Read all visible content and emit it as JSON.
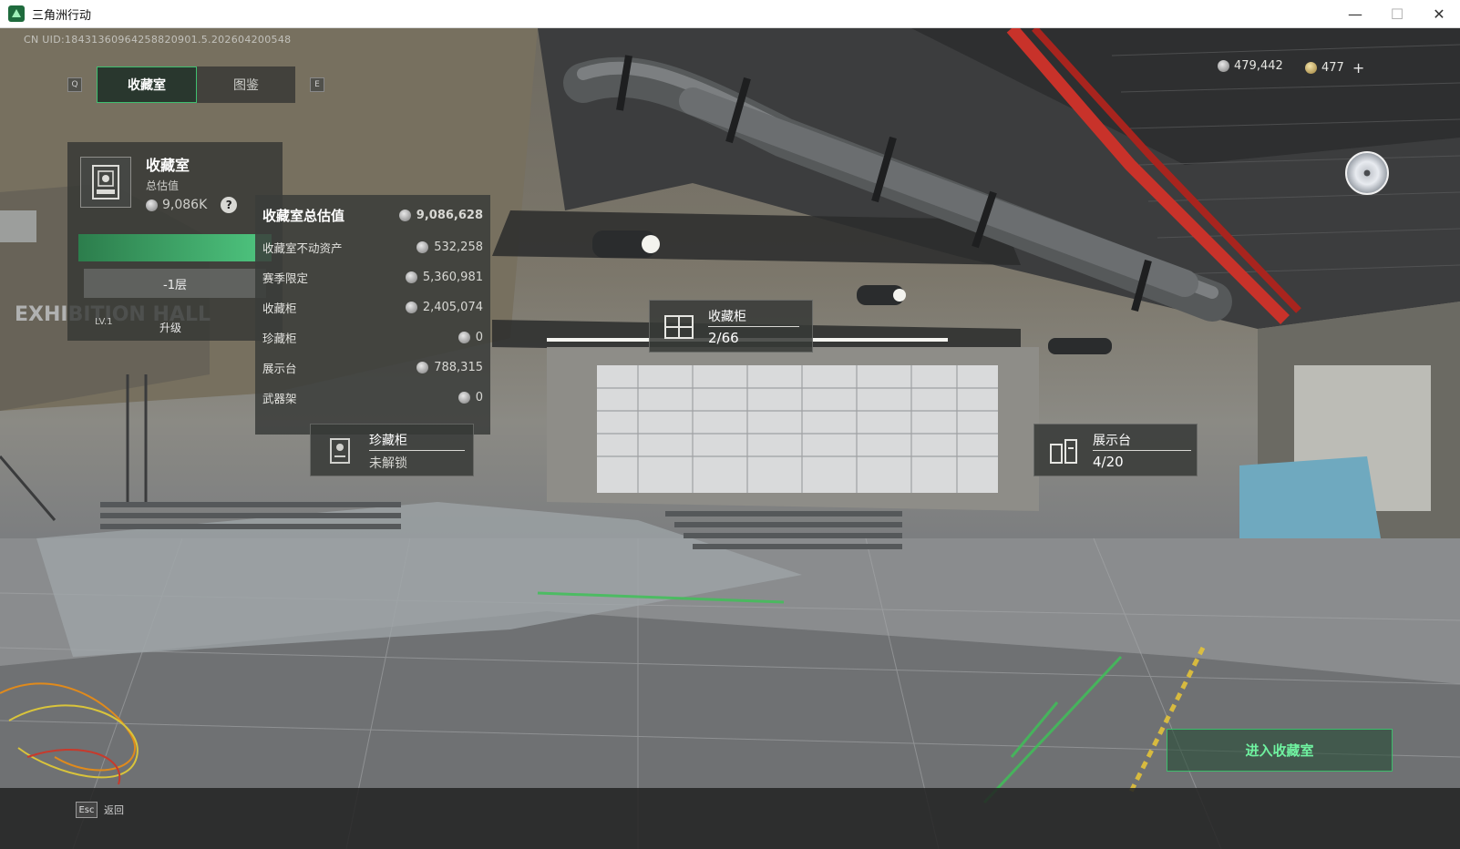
{
  "window": {
    "title": "三角洲行动",
    "controls": {
      "minimize": "—",
      "maximize": "☐",
      "close": "✕"
    }
  },
  "uid": "CN UID:18431360964258820901.5.202604200548",
  "nav": {
    "left_key": "Q",
    "right_key": "E",
    "tabs": [
      {
        "label": "收藏室",
        "active": true
      },
      {
        "label": "图鉴",
        "active": false
      }
    ]
  },
  "currency": {
    "silver": "479,442",
    "gold": "477",
    "add": "+"
  },
  "room_card": {
    "name": "收藏室",
    "subtitle": "总估值",
    "value": "9,086K",
    "help": "?",
    "level": "LV.1",
    "floor": "-1层",
    "upgrade": "升级"
  },
  "value_panel": {
    "title": "收藏室总估值",
    "total": "9,086,628",
    "rows": [
      {
        "label": "收藏室不动资产",
        "value": "532,258"
      },
      {
        "label": "赛季限定",
        "value": "5,360,981"
      },
      {
        "label": "收藏柜",
        "value": "2,405,074"
      },
      {
        "label": "珍藏柜",
        "value": "0"
      },
      {
        "label": "展示台",
        "value": "788,315"
      },
      {
        "label": "武器架",
        "value": "0"
      }
    ]
  },
  "tags": {
    "cabinet": {
      "title": "收藏柜",
      "count": "2/66"
    },
    "treasure": {
      "title": "珍藏柜",
      "status": "未解锁"
    },
    "display": {
      "title": "展示台",
      "count": "4/20"
    }
  },
  "scene_text": {
    "exhibition": "EXHIBITION HALL"
  },
  "enter_button": "进入收藏室",
  "footer": {
    "key": "Esc",
    "label": "返回"
  },
  "colors": {
    "accent_green": "#3fbf70",
    "pipe_red": "#c8322a"
  },
  "icons": [
    "app-logo-icon",
    "coin-icon",
    "gold-coin-icon",
    "help-icon",
    "cabinet-icon",
    "treasure-cabinet-icon",
    "display-stand-icon",
    "disc-icon"
  ]
}
